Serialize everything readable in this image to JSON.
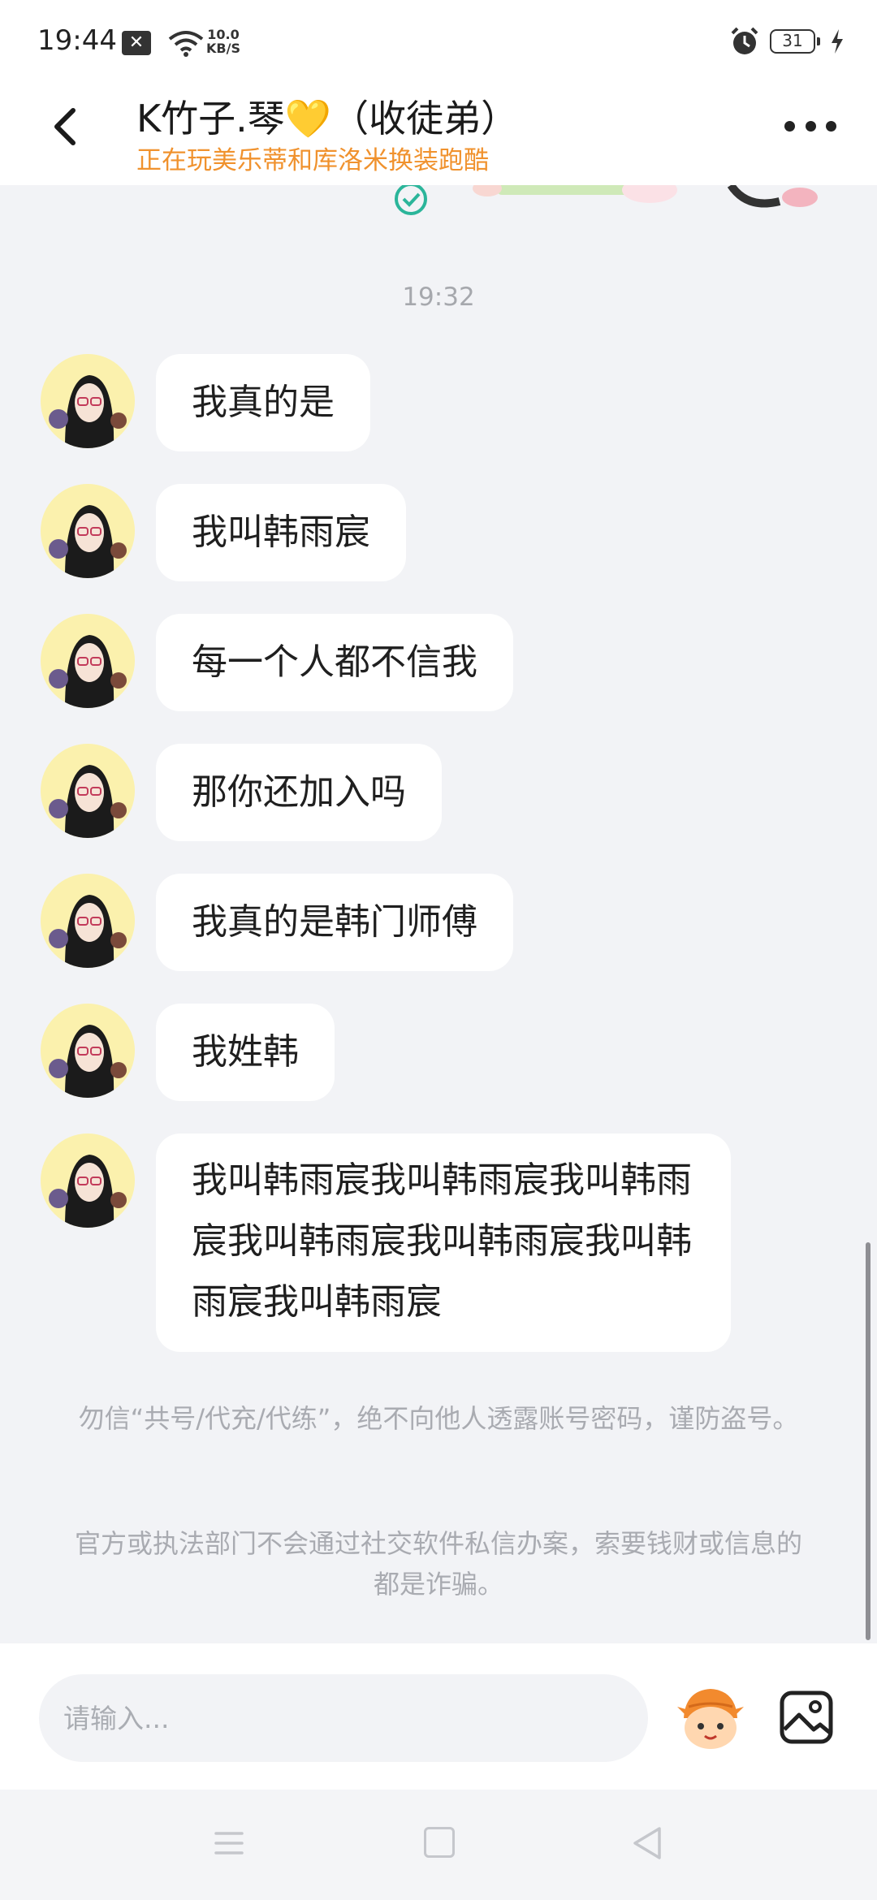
{
  "status_bar": {
    "time": "19:44",
    "speed_value": "10.0",
    "speed_unit": "KB/S",
    "battery": "31",
    "icons": [
      "notification-x-icon",
      "wifi-icon",
      "alarm-icon",
      "battery-icon",
      "charging-icon"
    ]
  },
  "header": {
    "title": "K竹子.琴💛（收徒弟）",
    "subtitle": "正在玩美乐蒂和库洛米换装跑酷",
    "icons": [
      "back-arrow-icon",
      "more-dots-icon"
    ]
  },
  "chat": {
    "timestamp": "19:32",
    "messages": [
      {
        "text": "我真的是"
      },
      {
        "text": "我叫韩雨宸"
      },
      {
        "text": "每一个人都不信我"
      },
      {
        "text": "那你还加入吗"
      },
      {
        "text": "我真的是韩门师傅"
      },
      {
        "text": "我姓韩"
      },
      {
        "text": "我叫韩雨宸我叫韩雨宸我叫韩雨宸我叫韩雨宸我叫韩雨宸我叫韩雨宸我叫韩雨宸"
      }
    ],
    "notices": [
      "勿信“共号/代充/代练”，绝不向他人透露账号密码，谨防盗号。",
      "官方或执法部门不会通过社交软件私信办案，索要钱财或信息的都是诈骗。"
    ]
  },
  "input": {
    "placeholder": "请输入...",
    "value": "",
    "icons": [
      "emoji-mascot-icon",
      "image-icon"
    ]
  },
  "nav": {
    "icons": [
      "menu-icon",
      "home-square-icon",
      "back-triangle-icon"
    ]
  },
  "colors": {
    "accent": "#f0922e",
    "background": "#f2f3f6",
    "bubble": "#ffffff",
    "notice_text": "#a9abb1",
    "check_green": "#2bb59a"
  }
}
